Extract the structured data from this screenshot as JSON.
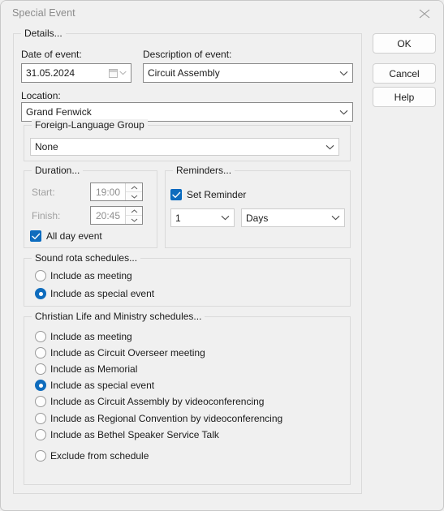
{
  "window": {
    "title": "Special Event",
    "close_icon": "close-icon"
  },
  "buttons": {
    "ok": "OK",
    "cancel": "Cancel",
    "help": "Help"
  },
  "details": {
    "legend": "Details...",
    "date_label": "Date of event:",
    "date_value": "31.05.2024",
    "description_label": "Description of event:",
    "description_value": "Circuit Assembly",
    "location_label": "Location:",
    "location_value": "Grand Fenwick",
    "foreign_language_group": {
      "legend": "Foreign-Language Group",
      "value": "None"
    }
  },
  "duration": {
    "legend": "Duration...",
    "start_label": "Start:",
    "start_value": "19:00",
    "finish_label": "Finish:",
    "finish_value": "20:45",
    "all_day_label": "All day event",
    "all_day_checked": true
  },
  "reminders": {
    "legend": "Reminders...",
    "set_reminder_label": "Set Reminder",
    "set_reminder_checked": true,
    "amount_value": "1",
    "unit_value": "Days"
  },
  "sound_rota": {
    "legend": "Sound rota schedules...",
    "options": [
      {
        "label": "Include as meeting",
        "selected": false
      },
      {
        "label": "Include as special event",
        "selected": true
      }
    ]
  },
  "christian_life": {
    "legend": "Christian Life and Ministry schedules...",
    "options": [
      {
        "label": "Include as meeting",
        "selected": false
      },
      {
        "label": "Include as Circuit Overseer meeting",
        "selected": false
      },
      {
        "label": "Include as Memorial",
        "selected": false
      },
      {
        "label": "Include as special event",
        "selected": true
      },
      {
        "label": "Include as Circuit Assembly by videoconferencing",
        "selected": false
      },
      {
        "label": "Include as Regional Convention by videoconferencing",
        "selected": false
      },
      {
        "label": "Include as Bethel Speaker Service Talk",
        "selected": false
      },
      {
        "label": "Exclude from schedule",
        "selected": false
      }
    ]
  },
  "colors": {
    "accent": "#0f6cbd",
    "window_bg": "#f0f0f0",
    "field_border": "#898989",
    "group_border": "#dadada"
  }
}
